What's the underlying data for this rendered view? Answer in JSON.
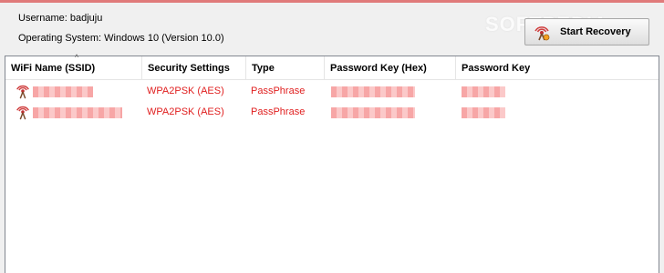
{
  "info": {
    "username": "Username: badjuju",
    "os": "Operating System: Windows 10 (Version 10.0)"
  },
  "watermark": "SOFTPEDIA",
  "start_button": {
    "label": "Start Recovery",
    "icon": "wifi-recovery-icon"
  },
  "table": {
    "columns": [
      "WiFi Name (SSID)",
      "Security Settings",
      "Type",
      "Password Key (Hex)",
      "Password Key"
    ],
    "sort_indicator": "^",
    "rows": [
      {
        "ssid": "",
        "security": "WPA2PSK (AES)",
        "type": "PassPhrase",
        "hex": "",
        "key": ""
      },
      {
        "ssid": "",
        "security": "WPA2PSK (AES)",
        "type": "PassPhrase",
        "hex": "",
        "key": ""
      }
    ]
  },
  "colors": {
    "accent": "#e02020",
    "redacted": "#f7a6a6",
    "top_line": "#e07a7a"
  }
}
